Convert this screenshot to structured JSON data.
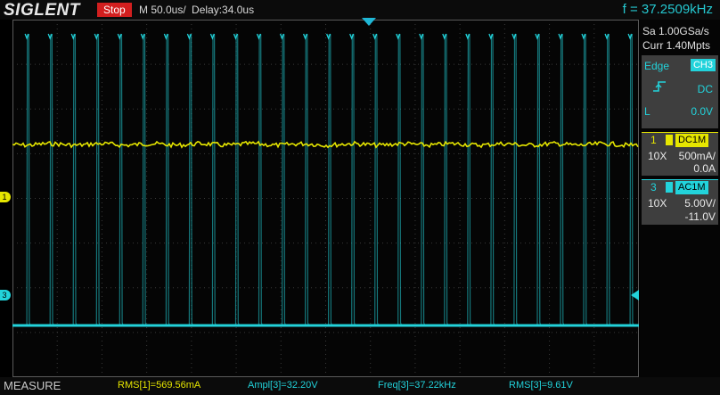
{
  "header": {
    "brand": "SIGLENT",
    "status": "Stop",
    "timebase": "M 50.0us/",
    "delay": "Delay:34.0us",
    "frequency": "f = 37.2509kHz"
  },
  "acquisition": {
    "sample_rate": "Sa 1.00GSa/s",
    "memory_depth": "Curr 1.40Mpts"
  },
  "trigger": {
    "type": "Edge",
    "source": "CH3",
    "slope_icon": "rising-edge-icon",
    "coupling": "DC",
    "level_label": "L",
    "level": "0.0V"
  },
  "channels": [
    {
      "number": "1",
      "coupling_badge": "DC1M",
      "probe": "10X",
      "scale": "500mA/",
      "offset": "0.0A",
      "color": "#e6e600"
    },
    {
      "number": "3",
      "coupling_badge": "AC1M",
      "probe": "10X",
      "scale": "5.00V/",
      "offset": "-11.0V",
      "color": "#22d3db"
    }
  ],
  "measure": {
    "title": "MEASURE",
    "items": [
      {
        "label": "RMS[1]=569.56mA",
        "color": "#e6e600"
      },
      {
        "label": "Ampl[3]=32.20V",
        "color": "#22d3db"
      },
      {
        "label": "Freq[3]=37.22kHz",
        "color": "#22d3db"
      },
      {
        "label": "RMS[3]=9.61V",
        "color": "#22d3db"
      }
    ]
  },
  "colors": {
    "accent": "#22d3db",
    "ch1": "#e6e600",
    "stop": "#d21f1f",
    "panel": "#3e3e3e"
  }
}
